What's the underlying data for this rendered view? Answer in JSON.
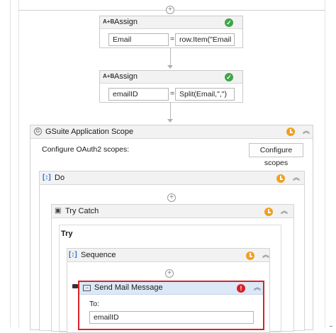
{
  "assign1": {
    "title": "Assign",
    "left_value": "Email",
    "eq": "=",
    "right_value": "row.Item(\"Email ID"
  },
  "assign2": {
    "title": "Assign",
    "left_value": "emailID",
    "eq": "=",
    "right_value": "Split(Email,\",\")"
  },
  "gsuite": {
    "title": "GSuite Application Scope",
    "oauth_label": "Configure OAuth2 scopes:",
    "configure_button": "Configure scopes"
  },
  "do": {
    "title": "Do"
  },
  "try_catch": {
    "title": "Try Catch",
    "try_label": "Try"
  },
  "sequence": {
    "title": "Sequence"
  },
  "send_mail": {
    "title": "Send Mail Message",
    "to_label": "To:",
    "to_value": "emailID"
  },
  "icons": {
    "assign": "A+B",
    "ok": "✓",
    "error": "!",
    "collapse": "︽",
    "plus": "+"
  },
  "colors": {
    "error_border": "#d9232b",
    "header_blue": "#dce8f5",
    "ok_green": "#3fa648",
    "warning_orange": "#f0a020"
  }
}
